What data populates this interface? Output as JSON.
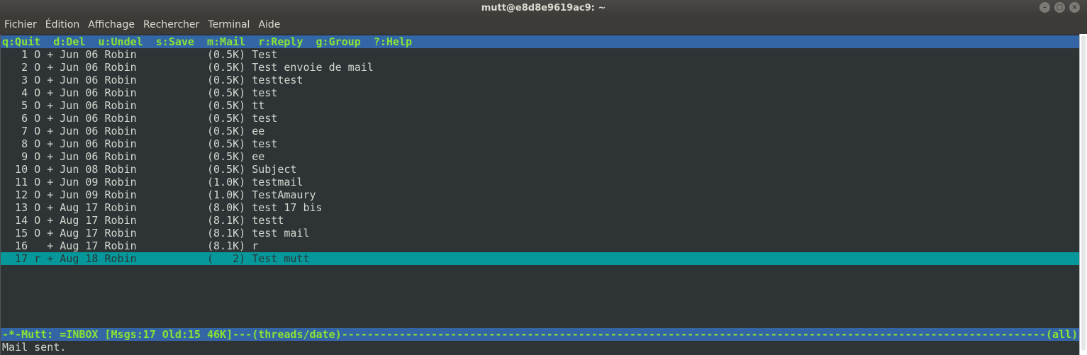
{
  "window": {
    "title": "mutt@e8d8e9619ac9: ~",
    "controls": {
      "minimize": "–",
      "maximize": "□",
      "close": "×"
    }
  },
  "menubar": [
    "Fichier",
    "Édition",
    "Affichage",
    "Rechercher",
    "Terminal",
    "Aide"
  ],
  "helpbar": "q:Quit  d:Del  u:Undel  s:Save  m:Mail  r:Reply  g:Group  ?:Help",
  "messages": [
    "   1 O + Jun 06 Robin           (0.5K) Test",
    "   2 O + Jun 06 Robin           (0.5K) Test envoie de mail",
    "   3 O + Jun 06 Robin           (0.5K) testtest",
    "   4 O + Jun 06 Robin           (0.5K) test",
    "   5 O + Jun 06 Robin           (0.5K) tt",
    "   6 O + Jun 06 Robin           (0.5K) test",
    "   7 O + Jun 06 Robin           (0.5K) ee",
    "   8 O + Jun 06 Robin           (0.5K) test",
    "   9 O + Jun 06 Robin           (0.5K) ee",
    "  10 O + Jun 08 Robin           (0.5K) Subject",
    "  11 O + Jun 09 Robin           (1.0K) testmail",
    "  12 O + Jun 09 Robin           (1.0K) TestAmaury",
    "  13 O + Aug 17 Robin           (8.0K) test 17 bis",
    "  14 O + Aug 17 Robin           (8.1K) testt",
    "  15 O + Aug 17 Robin           (8.1K) test mail",
    "  16   + Aug 17 Robin           (8.1K) r",
    "  17 r + Aug 18 Robin           (   2) Test mutt"
  ],
  "selected_index": 16,
  "statusbar": "-*-Mutt: =INBOX [Msgs:17 Old:15 46K]---(threads/date)--------------------------------------------------------------------------------------------------------------(all)---",
  "message_line": "Mail sent."
}
